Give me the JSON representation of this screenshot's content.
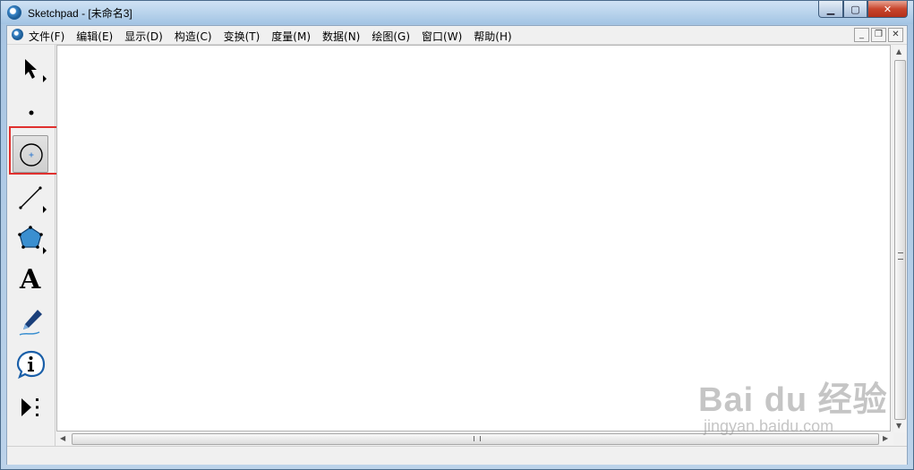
{
  "window": {
    "title": "Sketchpad",
    "doc_title": "- [未命名3]"
  },
  "menu": [
    "文件(F)",
    "编辑(E)",
    "显示(D)",
    "构造(C)",
    "变换(T)",
    "度量(M)",
    "数据(N)",
    "绘图(G)",
    "窗口(W)",
    "帮助(H)"
  ],
  "toolbox": {
    "selected_tool": "compass-tool",
    "text_tool_glyph": "A"
  },
  "watermark": {
    "logo": "Bai du 经验",
    "sub": "jingyan.baidu.com"
  },
  "colors": {
    "highlight": "#e0302e",
    "polygon_fill": "#3a8fd0"
  }
}
